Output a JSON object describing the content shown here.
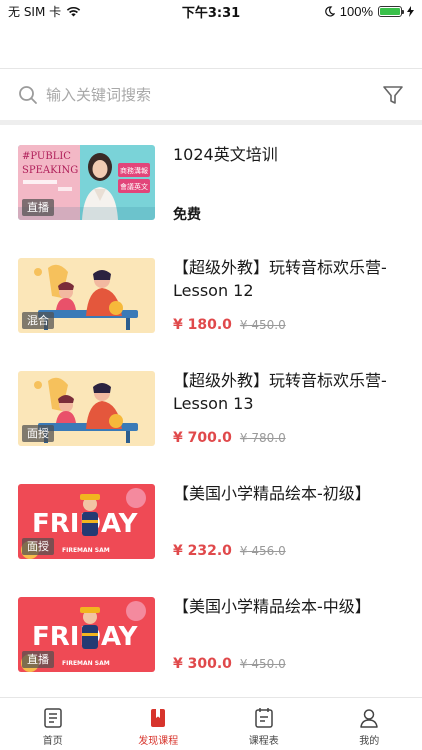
{
  "status_bar": {
    "carrier": "无 SIM 卡",
    "time": "下午3:31",
    "battery_percent": "100%",
    "battery_level": 1.0
  },
  "search": {
    "placeholder": "输入关键词搜索"
  },
  "courses": [
    {
      "title": "1024英文培训",
      "badge": "直播",
      "price": "免费",
      "original_price": "",
      "thumb_kind": "public-speaking",
      "thumb_text": [
        "#PUBLIC",
        "SPEAKING",
        "商務溝報",
        "會議英文"
      ]
    },
    {
      "title": "【超级外教】玩转音标欢乐营-Lesson 12",
      "badge": "混合",
      "price": "¥ 180.0",
      "original_price": "¥ 450.0",
      "thumb_kind": "phonics"
    },
    {
      "title": "【超级外教】玩转音标欢乐营-Lesson 13",
      "badge": "面授",
      "price": "¥ 700.0",
      "original_price": "¥ 780.0",
      "thumb_kind": "phonics"
    },
    {
      "title": "【美国小学精品绘本-初级】",
      "badge": "面授",
      "price": "¥ 232.0",
      "original_price": "¥ 456.0",
      "thumb_kind": "friday",
      "thumb_text": [
        "FRIDAY",
        "FIREMAN SAM"
      ]
    },
    {
      "title": "【美国小学精品绘本-中级】",
      "badge": "直播",
      "price": "¥ 300.0",
      "original_price": "¥ 450.0",
      "thumb_kind": "friday",
      "thumb_text": [
        "FRIDAY",
        "FIREMAN SAM"
      ]
    }
  ],
  "tabs": [
    {
      "label": "首页",
      "icon": "home-icon",
      "active": false
    },
    {
      "label": "发现课程",
      "icon": "discover-icon",
      "active": true
    },
    {
      "label": "课程表",
      "icon": "schedule-icon",
      "active": false
    },
    {
      "label": "我的",
      "icon": "profile-icon",
      "active": false
    }
  ],
  "colors": {
    "accent": "#d7342c",
    "price": "#e0494b",
    "battery": "#3ac04a"
  }
}
